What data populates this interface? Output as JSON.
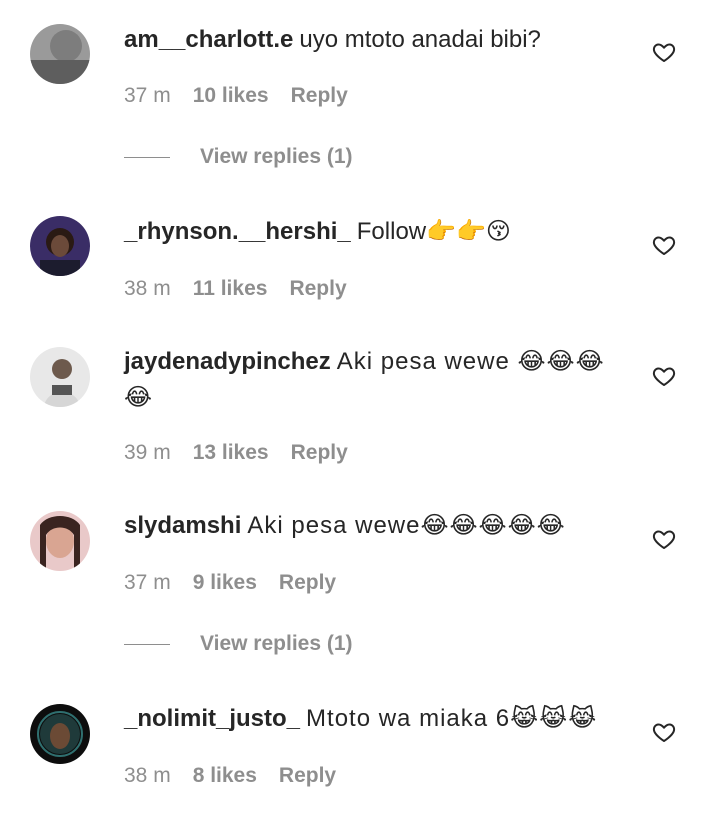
{
  "comments": [
    {
      "username": "am__charlott.e",
      "text": "uyo mtoto anadai bibi?",
      "time": "37 m",
      "likes": "10 likes",
      "reply": "Reply",
      "view_replies": "View replies (1)"
    },
    {
      "username": "_rhynson.__hershi_",
      "text": "Follow👉👉😚",
      "time": "38 m",
      "likes": "11 likes",
      "reply": "Reply"
    },
    {
      "username": "jaydenadypinchez",
      "text": "Aki pesa wewe 😂😂😂",
      "text_line2": "😂",
      "time": "39 m",
      "likes": "13 likes",
      "reply": "Reply"
    },
    {
      "username": "slydamshi",
      "text": "Aki pesa wewe😂😂😂😂😂",
      "time": "37 m",
      "likes": "9 likes",
      "reply": "Reply",
      "view_replies": "View replies (1)"
    },
    {
      "username": "_nolimit_justo_",
      "text": "Mtoto wa miaka 6😹😹😹",
      "time": "38 m",
      "likes": "8 likes",
      "reply": "Reply"
    }
  ],
  "icons": {
    "like": "heart-outline-icon"
  },
  "colors": {
    "text": "#262626",
    "meta": "#8e8e8e",
    "background": "#ffffff"
  }
}
